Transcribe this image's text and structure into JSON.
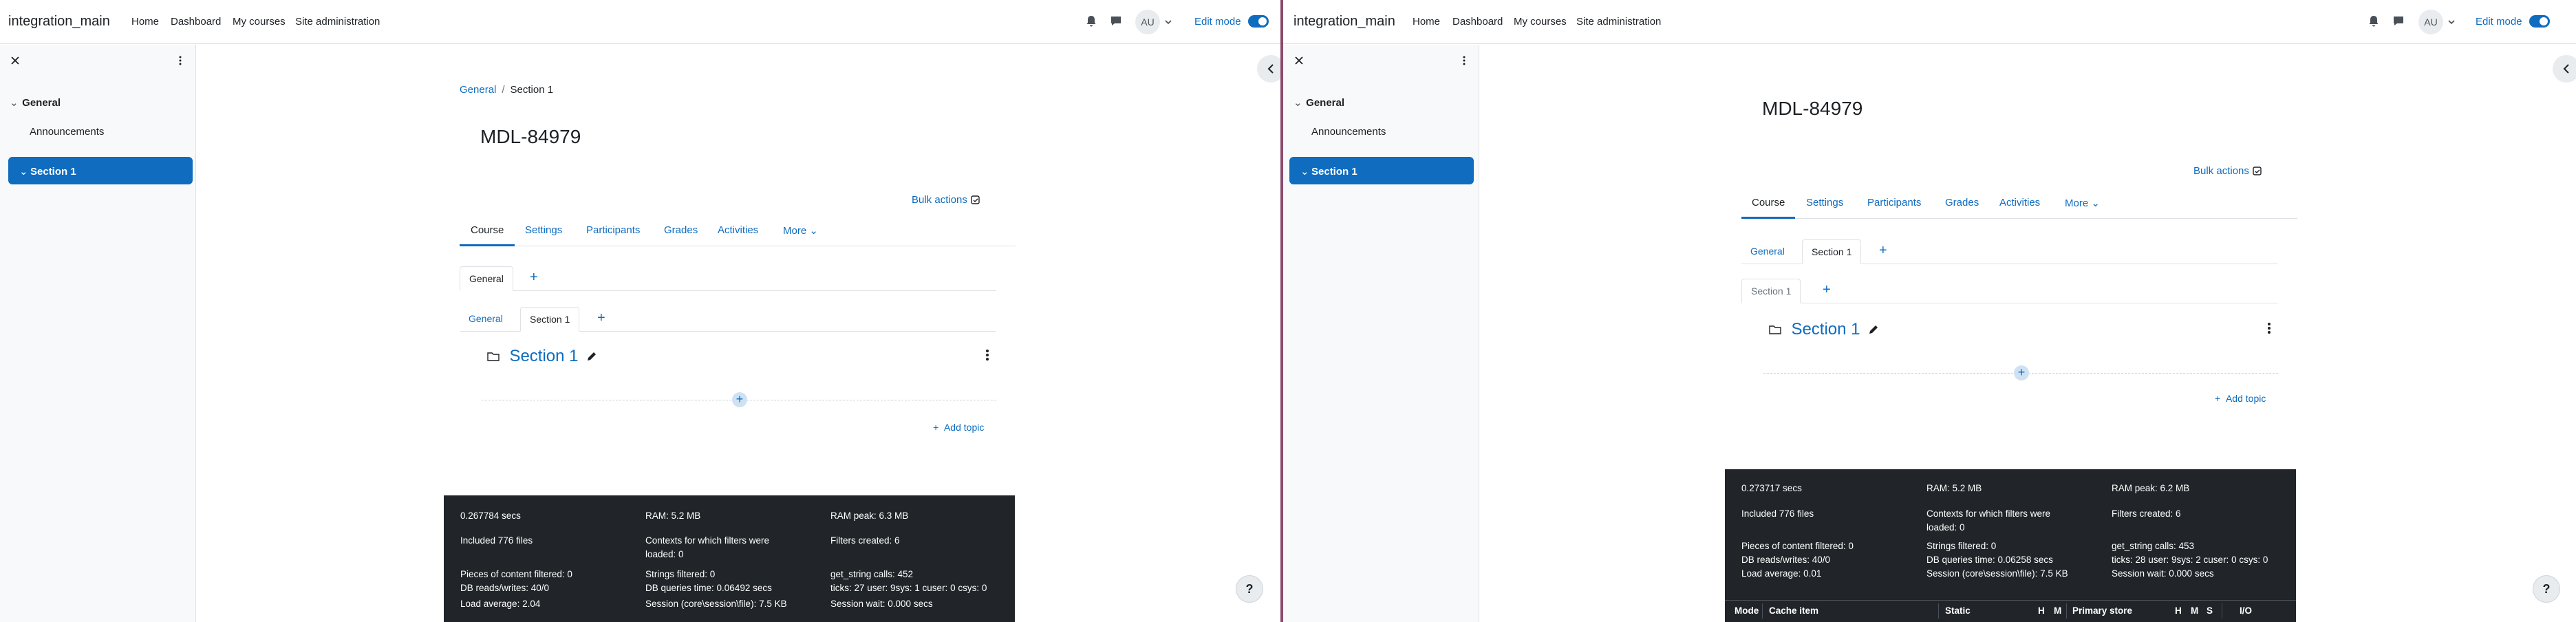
{
  "window_left": {
    "site_name": "integration_main",
    "nav": [
      "Home",
      "Dashboard",
      "My courses",
      "Site administration"
    ],
    "avatar_initials": "AU",
    "edit_mode_label": "Edit mode",
    "drawer": {
      "section_label": "General",
      "item_label": "Announcements",
      "active_label": "Section 1"
    },
    "breadcrumb": [
      "General",
      "Section 1"
    ],
    "page_title": "MDL-84979",
    "bulk_actions": "Bulk actions",
    "secondary_nav": [
      "Course",
      "Settings",
      "Participants",
      "Grades",
      "Activities",
      "More"
    ],
    "tabs_row1": [
      "General"
    ],
    "tabs_row2": [
      "General",
      "Section 1"
    ],
    "section_title": "Section 1",
    "add_topic": "Add topic",
    "perf": {
      "c1": [
        "0.267784 secs",
        "Included 776 files",
        "Pieces of content filtered: 0",
        "DB reads/writes: 40/0",
        "Load average: 2.04"
      ],
      "c2": [
        "RAM: 5.2 MB",
        "Contexts for which filters were",
        "loaded: 0",
        "Strings filtered: 0",
        "DB queries time: 0.06492 secs",
        "Session (core\\session\\file): 7.5 KB"
      ],
      "c3": [
        "RAM peak: 6.3 MB",
        "Filters created: 6",
        "get_string calls: 452",
        "ticks: 27 user: 9sys: 1 cuser: 0 csys: 0",
        "Session wait: 0.000 secs"
      ]
    }
  },
  "window_right": {
    "site_name": "integration_main",
    "nav": [
      "Home",
      "Dashboard",
      "My courses",
      "Site administration"
    ],
    "avatar_initials": "AU",
    "edit_mode_label": "Edit mode",
    "drawer": {
      "section_label": "General",
      "item_label": "Announcements",
      "active_label": "Section 1"
    },
    "page_title": "MDL-84979",
    "bulk_actions": "Bulk actions",
    "secondary_nav": [
      "Course",
      "Settings",
      "Participants",
      "Grades",
      "Activities",
      "More"
    ],
    "tabs_row1": [
      "General",
      "Section 1"
    ],
    "tabs_row2": [
      "Section 1"
    ],
    "section_title": "Section 1",
    "add_topic": "Add topic",
    "perf": {
      "c1": [
        "0.273717 secs",
        "Included 776 files",
        "Pieces of content filtered: 0",
        "DB reads/writes: 40/0",
        "Load average: 0.01"
      ],
      "c2": [
        "RAM: 5.2 MB",
        "Contexts for which filters were",
        "loaded: 0",
        "Strings filtered: 0",
        "DB queries time: 0.06258 secs",
        "Session (core\\session\\file): 7.5 KB"
      ],
      "c3": [
        "RAM peak: 6.2 MB",
        "Filters created: 6",
        "get_string calls: 453",
        "ticks: 28 user: 9sys: 2 cuser: 0 csys: 0",
        "Session wait: 0.000 secs"
      ],
      "table_headers": [
        "Mode",
        "Cache item",
        "Static",
        "H",
        "M",
        "Primary store",
        "H",
        "M",
        "S",
        "I/O"
      ]
    }
  },
  "help_label": "?",
  "colors": {
    "primary": "#0f6cbf",
    "footer_bg": "#212529",
    "divider": "#8a4a6b"
  },
  "icons": [
    "bell-icon",
    "chat-icon",
    "chevron-down-icon",
    "close-icon",
    "kebab-icon",
    "folder-icon",
    "pencil-icon",
    "bulk-icon",
    "chevron-left-icon"
  ]
}
